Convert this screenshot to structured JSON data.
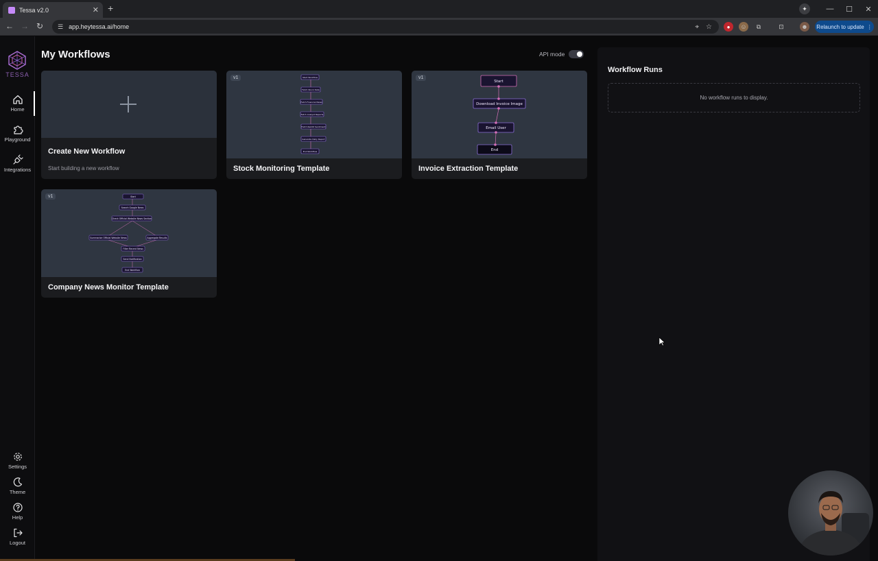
{
  "browser": {
    "tab_title": "Tessa v2.0",
    "url": "app.heytessa.ai/home",
    "relaunch_label": "Relaunch to update"
  },
  "sidebar": {
    "logo_text": "TESSA",
    "items": [
      {
        "label": "Home",
        "icon": "home-icon"
      },
      {
        "label": "Playground",
        "icon": "puzzle-icon"
      },
      {
        "label": "Integrations",
        "icon": "plug-icon"
      }
    ],
    "bottom_items": [
      {
        "label": "Settings",
        "icon": "gear-icon"
      },
      {
        "label": "Theme",
        "icon": "moon-icon"
      },
      {
        "label": "Help",
        "icon": "help-icon"
      },
      {
        "label": "Logout",
        "icon": "logout-icon"
      }
    ]
  },
  "main": {
    "title": "My Workflows",
    "api_mode_label": "API mode",
    "api_mode_on": false,
    "create_card": {
      "title": "Create New Workflow",
      "subtitle": "Start building a new workflow"
    },
    "templates": [
      {
        "title": "Stock Monitoring Template",
        "version": "v1",
        "nodes": [
          "Start Workflow",
          "Fetch Stock Data",
          "Fetch Financial News",
          "Fetch Analyst Reports",
          "Fetch Reddit Sentiment",
          "Generate Daily Report",
          "End Workflow"
        ]
      },
      {
        "title": "Invoice Extraction Template",
        "version": "v1",
        "nodes": [
          "Start",
          "Download Invoice Image",
          "Email User",
          "End"
        ]
      },
      {
        "title": "Company News Monitor Template",
        "version": "v1",
        "nodes": [
          "Start",
          "Search Google News",
          "Check Official Website News Section",
          "Summarize Official Website News",
          "Aggregate Results",
          "Filter Recent News",
          "Send Notification",
          "End Workflow"
        ]
      }
    ]
  },
  "runs": {
    "title": "Workflow Runs",
    "empty_text": "No workflow runs to display."
  },
  "colors": {
    "accent": "#c58af9",
    "node_fill": "#1a1430",
    "node_border": "#8a6fd6",
    "connector": "#d36fb6"
  }
}
